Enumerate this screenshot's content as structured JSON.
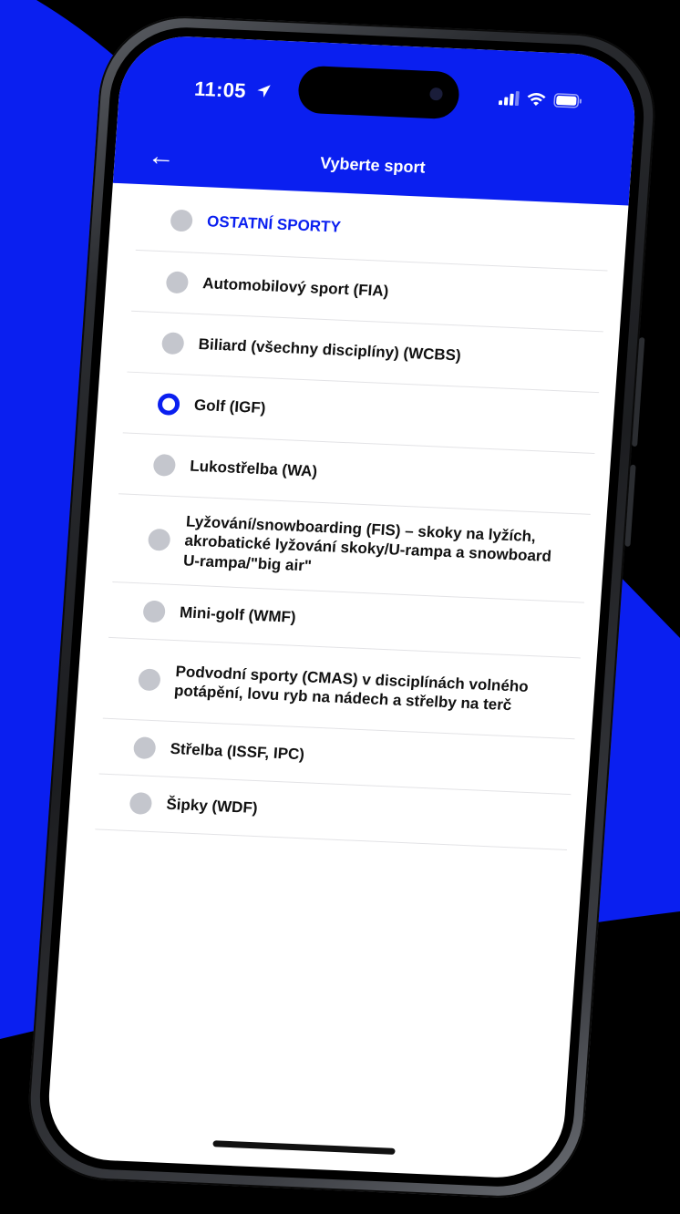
{
  "status_bar": {
    "time": "11:05",
    "icons": [
      "location-arrow-icon",
      "signal-icon",
      "wifi-icon",
      "battery-icon"
    ]
  },
  "nav": {
    "back_icon": "arrow-left-icon",
    "back_glyph": "←",
    "title": "Vyberte sport"
  },
  "colors": {
    "accent": "#0a1ff0",
    "radio_unselected": "#c4c6cd",
    "background_shape": "#0a1ff0"
  },
  "sports": [
    {
      "label": "OSTATNÍ SPORTY",
      "selected": false,
      "category": true
    },
    {
      "label": "Automobilový sport (FIA)",
      "selected": false
    },
    {
      "label": "Biliard (všechny disciplíny) (WCBS)",
      "selected": false
    },
    {
      "label": "Golf (IGF)",
      "selected": true
    },
    {
      "label": "Lukostřelba (WA)",
      "selected": false
    },
    {
      "label": "Lyžování/snowboarding (FIS) – skoky na lyžích, akrobatické lyžování skoky/U-rampa a snowboard U-rampa/\"big air\"",
      "selected": false
    },
    {
      "label": "Mini-golf (WMF)",
      "selected": false
    },
    {
      "label": "Podvodní sporty (CMAS) v disciplínách volného potápění, lovu ryb na nádech a střelby na terč",
      "selected": false
    },
    {
      "label": "Střelba (ISSF, IPC)",
      "selected": false
    },
    {
      "label": "Šipky (WDF)",
      "selected": false
    }
  ]
}
